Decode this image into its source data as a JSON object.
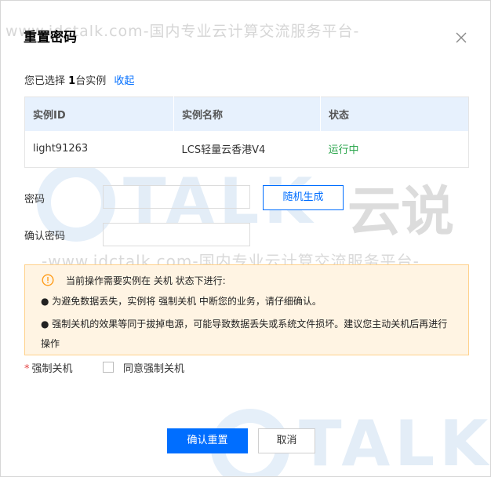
{
  "watermark": {
    "top_text": "www.idctalk.com-国内专业云计算交流服务平台-",
    "logo_latin": "TALK",
    "logo_cn": "云说",
    "url_text": "-www.idctalk.com-国内专业云计算交流服务平台-"
  },
  "dialog": {
    "title": "重置密码",
    "close_icon": "close-icon"
  },
  "selection": {
    "prefix": "您已选择",
    "count": "1",
    "suffix": "台实例",
    "collapse_label": "收起"
  },
  "table": {
    "headers": [
      "实例ID",
      "实例名称",
      "状态"
    ],
    "rows": [
      {
        "id": "light91263",
        "name": "LCS轻量云香港V4",
        "status": "运行中"
      }
    ],
    "status_color": "#29a54b"
  },
  "form": {
    "password_label": "密码",
    "password_value": "",
    "random_button": "随机生成",
    "confirm_label": "确认密码",
    "confirm_value": ""
  },
  "warning": {
    "icon": "warning-circle-icon",
    "head": "当前操作需要实例在 关机 状态下进行:",
    "bullet1": "● 为避免数据丢失，实例将 强制关机 中断您的业务，请仔细确认。",
    "bullet2": "● 强制关机的效果等同于拔掉电源，可能导致数据丢失或系统文件损坏。建议您主动关机后再进行操作"
  },
  "force": {
    "required_mark": "*",
    "label": "强制关机",
    "checkbox_label": "同意强制关机",
    "checked": false
  },
  "footer": {
    "confirm_button": "确认重置",
    "cancel_button": "取消"
  },
  "colors": {
    "accent": "#006eff",
    "warning_bg": "#fff4e3",
    "warning_border": "#ffd18b",
    "table_header_bg": "#e7f1fd"
  }
}
